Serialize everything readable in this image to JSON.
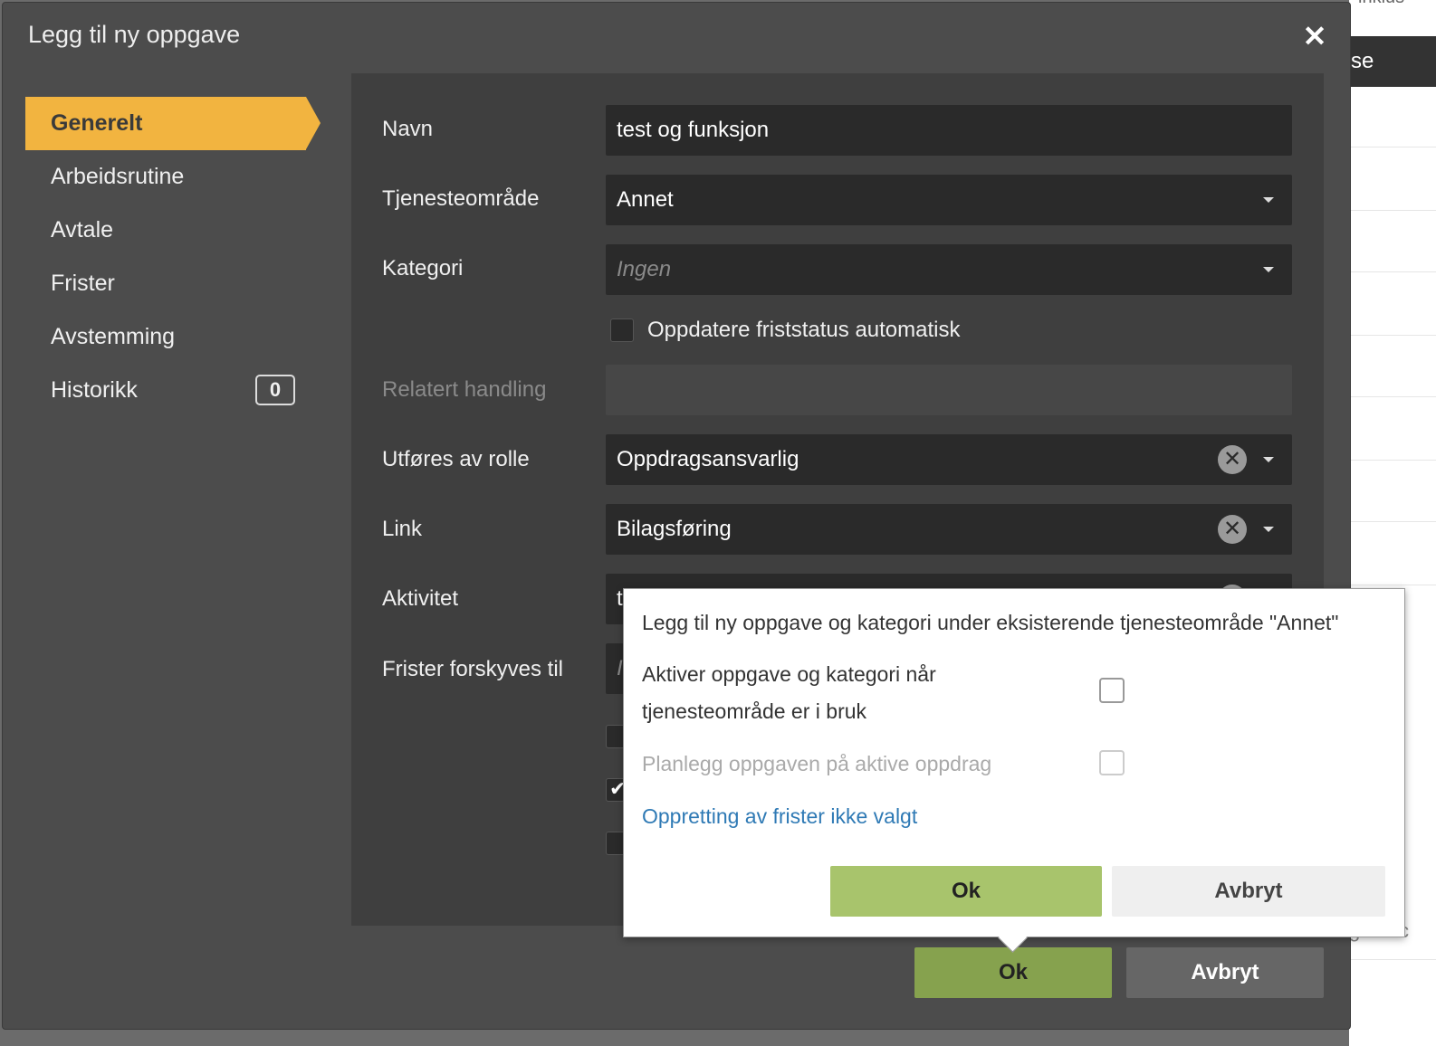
{
  "background": {
    "top_fragment": "inklus",
    "header_fragment": "se",
    "row_fragment": "g behc"
  },
  "dialog": {
    "title": "Legg til ny oppgave",
    "close_icon": "close-icon"
  },
  "sidebar": {
    "items": [
      {
        "label": "Generelt",
        "active": true
      },
      {
        "label": "Arbeidsrutine"
      },
      {
        "label": "Avtale"
      },
      {
        "label": "Frister"
      },
      {
        "label": "Avstemming"
      },
      {
        "label": "Historikk",
        "badge": "0"
      }
    ]
  },
  "form": {
    "navn": {
      "label": "Navn",
      "value": "test og funksjon"
    },
    "tjenesteomrade": {
      "label": "Tjenesteområde",
      "value": "Annet"
    },
    "kategori": {
      "label": "Kategori",
      "placeholder": "Ingen"
    },
    "oppdatere": {
      "label": "Oppdatere friststatus automatisk",
      "checked": false
    },
    "relatert": {
      "label": "Relatert handling",
      "value": ""
    },
    "utfores": {
      "label": "Utføres av rolle",
      "value": "Oppdragsansvarlig"
    },
    "link": {
      "label": "Link",
      "value": "Bilagsføring"
    },
    "aktivitet": {
      "label": "Aktivitet",
      "value_fragment": "t"
    },
    "frister": {
      "label": "Frister forskyves til",
      "placeholder_fragment": "I"
    }
  },
  "footer": {
    "ok_label": "Ok",
    "cancel_label": "Avbryt"
  },
  "popover": {
    "title": "Legg til ny oppgave og kategori under eksisterende tjenesteområde \"Annet\"",
    "aktiver_label_line1": "Aktiver oppgave og kategori når",
    "aktiver_label_line2": "tjenesteområde er i bruk",
    "planlegg_label": "Planlegg oppgaven på aktive oppdrag",
    "link_text": "Oppretting av frister ikke valgt",
    "ok_label": "Ok",
    "cancel_label": "Avbryt"
  },
  "colors": {
    "accent": "#f2b440",
    "ok_green": "#86a24e",
    "link_blue": "#2f7ab5"
  }
}
